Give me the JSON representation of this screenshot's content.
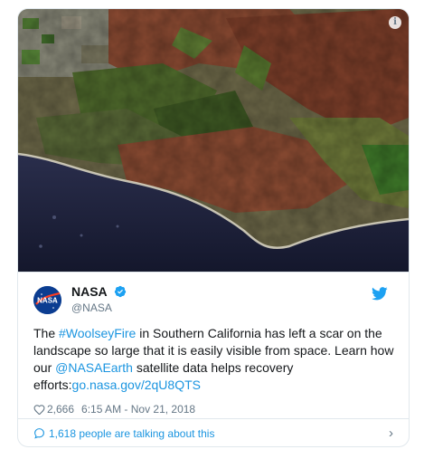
{
  "tweet": {
    "author_name": "NASA",
    "author_handle": "@NASA",
    "avatar_label": "NASA",
    "text": {
      "before_hashtag": "The ",
      "hashtag": "#WoolseyFire",
      "after_hashtag": " in Southern California has left a scar on the landscape so large that it is easily visible from space. Learn how our ",
      "mention": "@NASAEarth",
      "after_mention": " satellite data helps recovery efforts:",
      "url": "go.nasa.gov/2qU8QTS"
    },
    "likes": "2,666",
    "timestamp": "6:15 AM - Nov 21, 2018",
    "talking_about": "1,618 people are talking about this",
    "info_icon": "i",
    "chevron": "›"
  },
  "icons": {
    "verified": "verified-badge-icon",
    "twitter": "twitter-bird-icon",
    "heart": "heart-icon",
    "comment": "comment-bubble-icon",
    "info": "info-icon",
    "chevron": "chevron-right-icon"
  },
  "colors": {
    "link": "#1b95e0",
    "muted": "#657786",
    "text": "#14171a",
    "border": "#e1e8ed",
    "burn_scar": "#8a4a32",
    "ocean": "#1a1f3a"
  }
}
